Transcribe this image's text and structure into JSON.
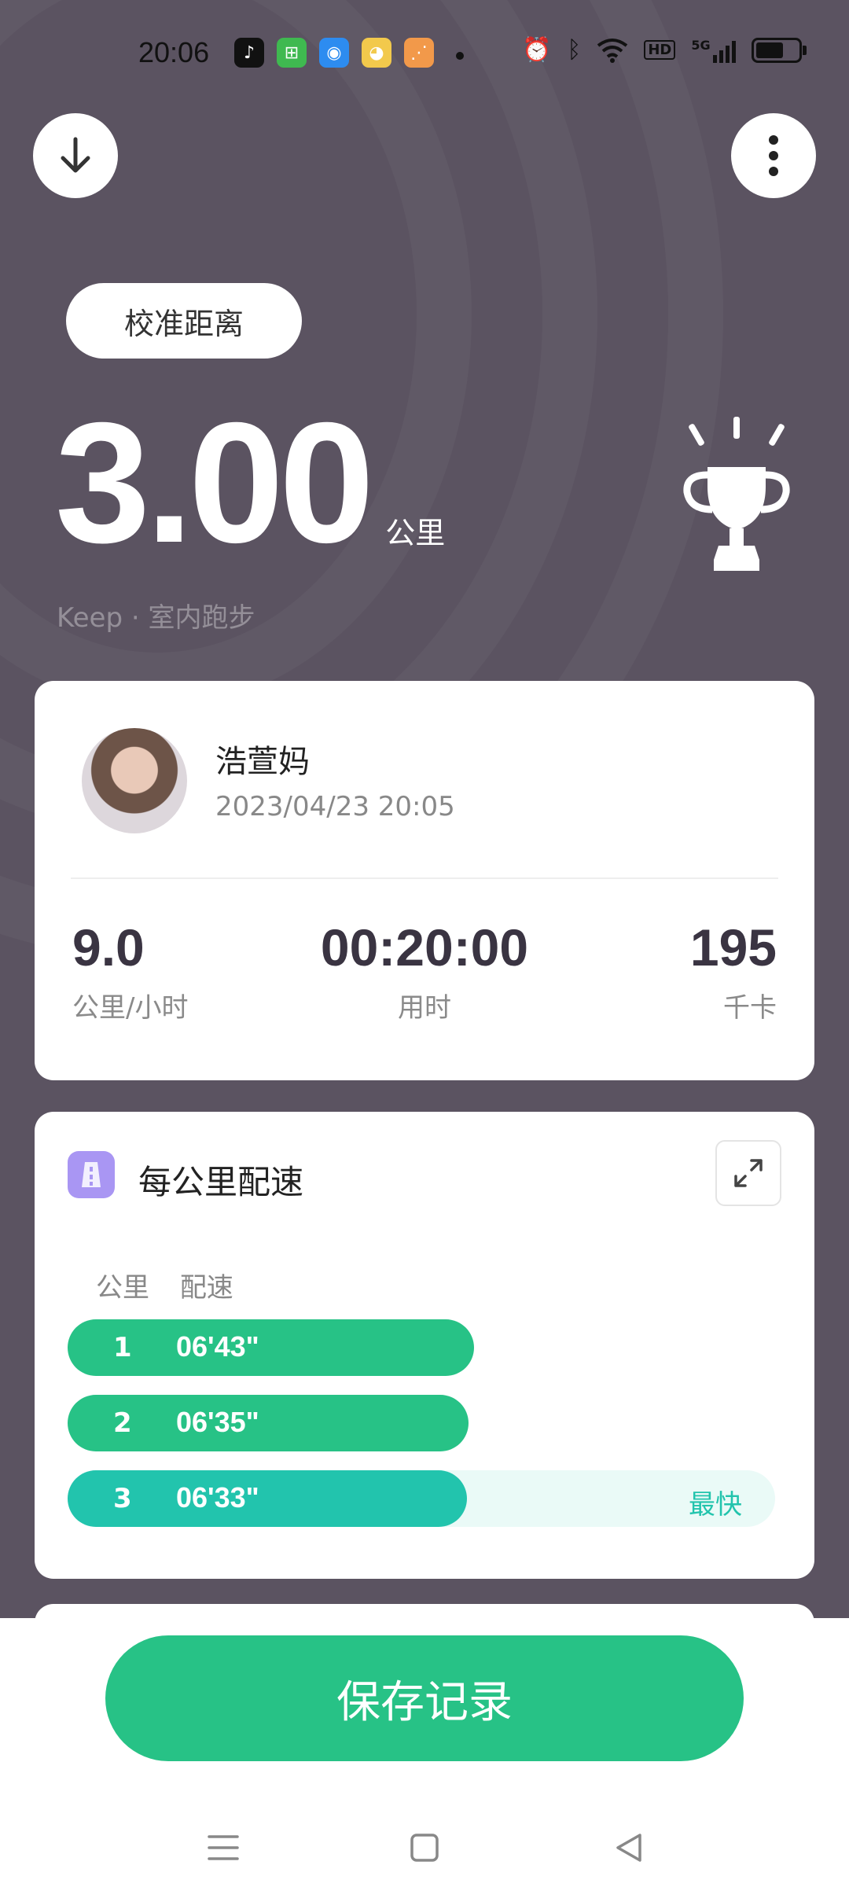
{
  "status_bar": {
    "time": "20:06",
    "apps": [
      {
        "icon": "tiktok-icon",
        "color": "#111111",
        "glyph": "♪"
      },
      {
        "icon": "app-green-icon",
        "color": "#3fb950",
        "glyph": "⊞"
      },
      {
        "icon": "app-blue-icon",
        "color": "#2d8cf0",
        "glyph": "◉"
      },
      {
        "icon": "weibo-icon",
        "color": "#f2c94c",
        "glyph": "◕"
      },
      {
        "icon": "app-orange-icon",
        "color": "#f2994a",
        "glyph": "⋰"
      }
    ],
    "hd_label": "HD",
    "network_label": "5G"
  },
  "header": {
    "calibrate_label": "校准距离"
  },
  "summary": {
    "distance": "3.00",
    "distance_unit": "公里",
    "source": "Keep · 室内跑步"
  },
  "user_card": {
    "name": "浩萱妈",
    "datetime": "2023/04/23 20:05",
    "stats": [
      {
        "value": "9.0",
        "label": "公里/小时"
      },
      {
        "value": "00:20:00",
        "label": "用时"
      },
      {
        "value": "195",
        "label": "千卡"
      }
    ]
  },
  "pace_card": {
    "title": "每公里配速",
    "col_km": "公里",
    "col_pace": "配速",
    "rows": [
      {
        "km": "1",
        "pace": "06'43\"",
        "fraction": 0.574,
        "fastest": false
      },
      {
        "km": "2",
        "pace": "06'35\"",
        "fraction": 0.567,
        "fastest": false
      },
      {
        "km": "3",
        "pace": "06'33\"",
        "fraction": 0.564,
        "fastest": true
      }
    ],
    "fastest_label": "最快"
  },
  "footer": {
    "save_label": "保存记录"
  },
  "colors": {
    "background": "#5b5361",
    "accent_green": "#27c286",
    "fastest_teal": "#22c4ad"
  }
}
